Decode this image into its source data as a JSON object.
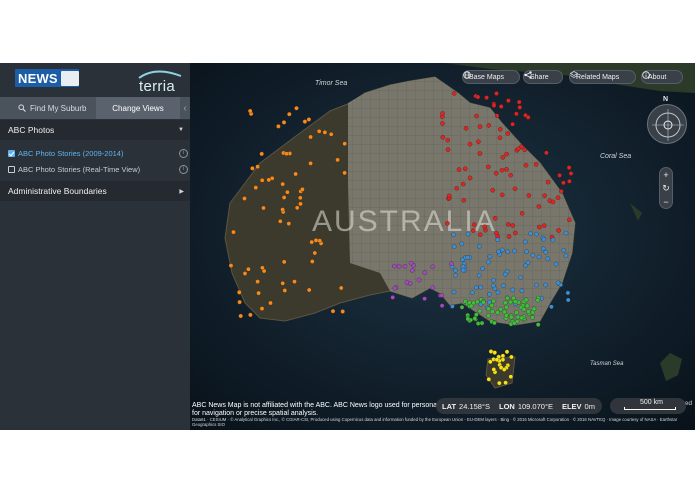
{
  "header": {
    "news_logo_text": "NEWS",
    "news_logo_subtext": "ABC",
    "terria_logo_text": "terria"
  },
  "tabs": {
    "find_my_suburb": "Find My Suburb",
    "change_views": "Change Views",
    "collapse_glyph": "‹"
  },
  "sidebar": {
    "abc_photos": "ABC Photos",
    "items": [
      {
        "label": "ABC Photo Stories (2009-2014)",
        "checked": true
      },
      {
        "label": "ABC Photo Stories (Real-Time View)",
        "checked": false
      }
    ],
    "administrative_boundaries": "Administrative Boundaries"
  },
  "toolbar": {
    "base_maps": "Base Maps",
    "share": "Share",
    "related_maps": "Related Maps",
    "about": "About"
  },
  "compass": {
    "north_label": "N"
  },
  "zoom": {
    "in": "+",
    "reset": "↻",
    "out": "−"
  },
  "map_labels": {
    "timor_sea": "Timor Sea",
    "coral_sea": "Coral Sea",
    "tasman_sea": "Tasman Sea",
    "australia": "AUSTRALIA"
  },
  "location_bar": {
    "lat_label": "LAT",
    "lat_value": "24.158°S",
    "lon_label": "LON",
    "lon_value": "109.070°E",
    "elev_label": "ELEV",
    "elev_value": "0m"
  },
  "scale_bar": {
    "label": "500 km"
  },
  "disclaimer": "ABC News Map is not affiliated with the ABC. ABC News logo used for personal, non",
  "disclaimer_line2": "for navigation or precise spatial analysis.",
  "disclaimer_right": "p               sed",
  "credits": "Data61 · CESIUM · © Analytical Graphics Inc., © CGIAR-CSI, Produced using Copernicus data and information funded by the European Union - EU-DEM layers · Bing · © 2016 Microsoft Corporation · © 2016 NAVTEQ · Image courtesy of NASA · Earthstar Geographics SIO",
  "colors": {
    "wa": "#f58a1f",
    "qld": "#e02424",
    "nsw": "#3b8fd9",
    "sa": "#a24ac2",
    "vic": "#3fbf3f",
    "tas": "#f4e21a"
  }
}
